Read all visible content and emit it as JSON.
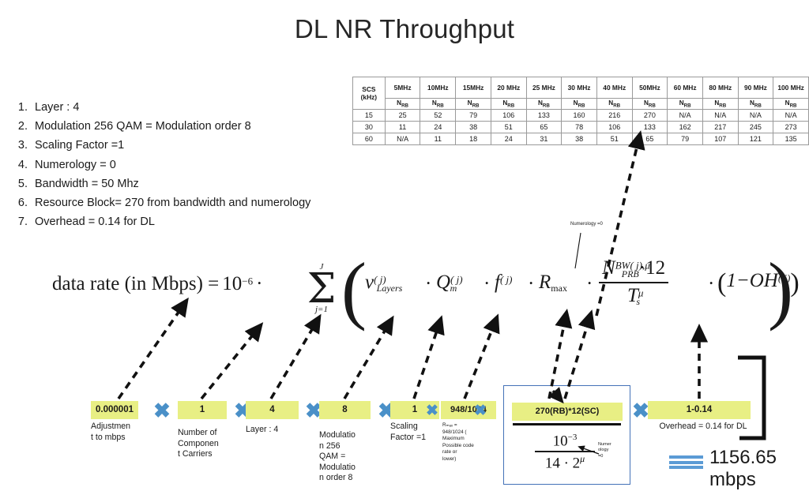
{
  "page": {
    "title": "DL NR Throughput"
  },
  "assumptions": {
    "items": [
      {
        "num": "1.",
        "text": "Layer : 4"
      },
      {
        "num": "2.",
        "text": "Modulation 256 QAM = Modulation order 8"
      },
      {
        "num": "3.",
        "text": "Scaling Factor =1"
      },
      {
        "num": "4.",
        "text": "Numerology  = 0"
      },
      {
        "num": "5.",
        "text": "Bandwidth =  50 Mhz"
      },
      {
        "num": "6.",
        "text": "Resource Block= 270  from bandwidth and numerology"
      },
      {
        "num": "7.",
        "text": "Overhead = 0.14 for DL"
      }
    ]
  },
  "nrb_table": {
    "corner_line1": "SCS",
    "corner_line2": "(kHz)",
    "bandwidth_headers": [
      "5MHz",
      "10MHz",
      "15MHz",
      "20 MHz",
      "25 MHz",
      "30 MHz",
      "40 MHz",
      "50MHz",
      "60 MHz",
      "80 MHz",
      "90 MHz",
      "100 MHz"
    ],
    "nrb_label": "N",
    "nrb_sub": "RB",
    "rows": [
      {
        "scs": "15",
        "values": [
          "25",
          "52",
          "79",
          "106",
          "133",
          "160",
          "216",
          "270",
          "N/A",
          "N/A",
          "N/A",
          "N/A"
        ]
      },
      {
        "scs": "30",
        "values": [
          "11",
          "24",
          "38",
          "51",
          "65",
          "78",
          "106",
          "133",
          "162",
          "217",
          "245",
          "273"
        ]
      },
      {
        "scs": "60",
        "values": [
          "N/A",
          "11",
          "18",
          "24",
          "31",
          "38",
          "51",
          "65",
          "79",
          "107",
          "121",
          "135"
        ]
      }
    ]
  },
  "formula": {
    "lhs": "data rate (in Mbps) =",
    "ten": "10",
    "ten_exp": "−6",
    "dot": "·",
    "sigma_upper": "J",
    "sigma_lower": "j=1",
    "term_v": "v",
    "term_v_sup": "( j)",
    "term_v_sub": "Layers",
    "term_q": "Q",
    "term_q_sup": "( j)",
    "term_q_sub": "m",
    "term_f": "f",
    "term_f_sup": "( j)",
    "term_r": "R",
    "term_r_sub": "max",
    "frac_num_n": "N",
    "frac_num_sup": "BW( j),μ",
    "frac_num_sub": "PRB",
    "frac_num_tail": "·12",
    "frac_den_t": "T",
    "frac_den_sub": "s",
    "frac_den_sup": "μ",
    "tail": "1−OH",
    "tail_sup": "( j)",
    "numerology_note": "Numerology  =0"
  },
  "product_row": {
    "items": [
      {
        "value": "0.000001",
        "caption": "Adjustmen\nt to mbps"
      },
      {
        "value": "1",
        "caption": "Number of\nComponen\nt Carriers"
      },
      {
        "value": "4",
        "caption": "Layer : 4"
      },
      {
        "value": "8",
        "caption": "Modulatio\nn 256\nQAM =\nModulatio\nn order 8"
      },
      {
        "value": "1",
        "caption": "Scaling\nFactor =1"
      },
      {
        "value": "948/1024",
        "caption": "Rₘₐₓ =\n948/1024 (\nMaximum\nPossible code\nrate or\nlower)"
      },
      {
        "value": "270(RB)*12(SC)",
        "caption": ""
      },
      {
        "value": "1-0.14",
        "caption": "Overhead = 0.14 for DL"
      }
    ],
    "multiply_symbol": "✖"
  },
  "rb_fraction": {
    "numerator": "270(RB)*12(SC)",
    "sub_numerator": "10",
    "sub_numerator_exp": "−3",
    "sub_denominator": "14 · 2",
    "sub_denominator_exp": "μ",
    "numerology_note": "Numer\nology\n=0"
  },
  "result": {
    "value": "1156.65 mbps"
  },
  "colors": {
    "highlight": "#e8ef84",
    "multiply_blue": "#4a90c8",
    "equals_blue": "#5b9bd5",
    "box_border_blue": "#4472b8"
  }
}
